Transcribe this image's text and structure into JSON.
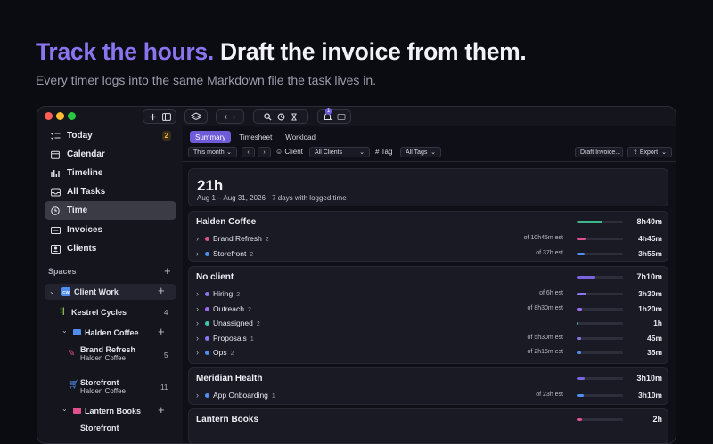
{
  "hero": {
    "headline_accent": "Track the hours.",
    "headline_rest": "Draft the invoice from them.",
    "subtitle": "Every timer logs into the same Markdown file the task lives in."
  },
  "colors": {
    "accent": "#8a74f0",
    "tab_active": "#6f5bd8",
    "traffic_red": "#ff5f57",
    "traffic_yellow": "#febc2e",
    "traffic_green": "#28c840"
  },
  "toolbar": {
    "notification_count": "1"
  },
  "sidebar": {
    "items": [
      {
        "label": "Today",
        "icon": "checklist-icon",
        "badge": "2"
      },
      {
        "label": "Calendar",
        "icon": "calendar-icon"
      },
      {
        "label": "Timeline",
        "icon": "timeline-icon"
      },
      {
        "label": "All Tasks",
        "icon": "inbox-icon"
      },
      {
        "label": "Time",
        "icon": "clock-icon",
        "selected": true
      },
      {
        "label": "Invoices",
        "icon": "invoice-icon"
      },
      {
        "label": "Clients",
        "icon": "contact-card-icon"
      }
    ],
    "spaces_label": "Spaces",
    "tree": {
      "client_work": {
        "label": "Client Work",
        "badge": "CW"
      },
      "kestrel": {
        "label": "Kestrel Cycles",
        "count": "4"
      },
      "halden": {
        "label": "Halden Coffee"
      },
      "brand_refresh": {
        "label": "Brand Refresh",
        "sub": "Halden Coffee",
        "count": "5"
      },
      "storefront": {
        "label": "Storefront",
        "sub": "Halden Coffee",
        "count": "11"
      },
      "lantern": {
        "label": "Lantern Books"
      },
      "storefront2": {
        "label": "Storefront"
      }
    }
  },
  "main": {
    "tabs": [
      "Summary",
      "Timesheet",
      "Workload"
    ],
    "filters": {
      "period": "This month",
      "client_label": "Client",
      "client_value": "All Clients",
      "tag_label": "Tag",
      "tag_value": "All Tags",
      "draft_invoice": "Draft Invoice...",
      "export": "Export"
    },
    "summary": {
      "total": "21h",
      "range": "Aug 1 – Aug 31, 2026 · 7 days with logged time"
    },
    "groups": [
      {
        "title": "Halden Coffee",
        "total": "8h40m",
        "fill": 0.55,
        "color": "#3fb68b",
        "rows": [
          {
            "name": "Brand Refresh",
            "count": "2",
            "est": "of 10h45m est",
            "hours": "4h45m",
            "dot": "#e0508f",
            "fill": 0.2
          },
          {
            "name": "Storefront",
            "count": "2",
            "est": "of 37h est",
            "hours": "3h55m",
            "dot": "#4f8ef0",
            "fill": 0.18
          }
        ]
      },
      {
        "title": "No client",
        "total": "7h10m",
        "fill": 0.4,
        "color": "#7a63e0",
        "rows": [
          {
            "name": "Hiring",
            "count": "2",
            "est": "of 6h est",
            "hours": "3h30m",
            "dot": "#8a74f0",
            "fill": 0.22
          },
          {
            "name": "Outreach",
            "count": "2",
            "est": "of 8h30m est",
            "hours": "1h20m",
            "dot": "#9a6bf0",
            "fill": 0.12
          },
          {
            "name": "Unassigned",
            "count": "2",
            "est": "",
            "hours": "1h",
            "dot": "#3fc7b0",
            "fill": 0.04
          },
          {
            "name": "Proposals",
            "count": "1",
            "est": "of 5h30m est",
            "hours": "45m",
            "dot": "#8a74f0",
            "fill": 0.1
          },
          {
            "name": "Ops",
            "count": "2",
            "est": "of 2h15m est",
            "hours": "35m",
            "dot": "#4f8ef0",
            "fill": 0.1
          }
        ]
      },
      {
        "title": "Meridian Health",
        "total": "3h10m",
        "fill": 0.18,
        "color": "#7a63e0",
        "rows": [
          {
            "name": "App Onboarding",
            "count": "1",
            "est": "of 23h est",
            "hours": "3h10m",
            "dot": "#4f8ef0",
            "fill": 0.15
          }
        ]
      },
      {
        "title": "Lantern Books",
        "total": "2h",
        "fill": 0.12,
        "color": "#e0508f",
        "rows": []
      }
    ]
  }
}
